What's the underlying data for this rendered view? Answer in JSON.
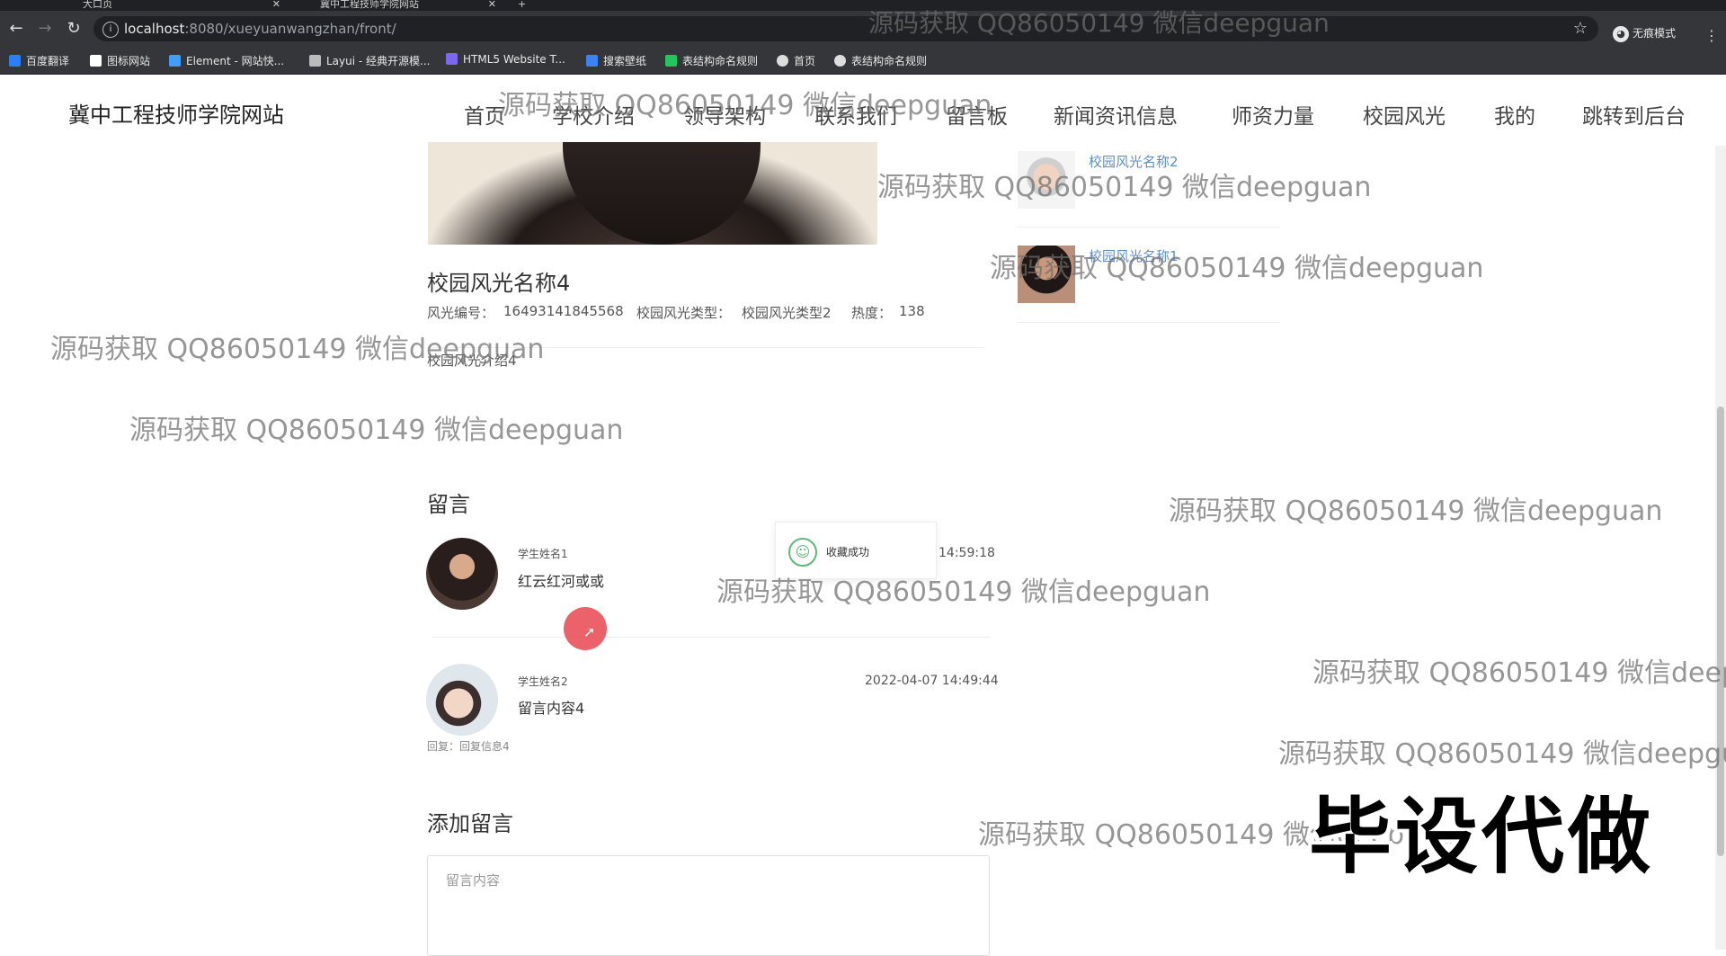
{
  "browser": {
    "tabs": [
      {
        "title": "大口页"
      },
      {
        "title": "冀中工程技师学院网站"
      }
    ],
    "new_tab": "+",
    "url_host": "localhost",
    "url_rest": ":8080/xueyuanwangzhan/front/",
    "profile": "无痕模式",
    "bookmarks": [
      {
        "label": "百度翻译",
        "color": "#2d7ff9"
      },
      {
        "label": "图标网站",
        "color": "#ffffff"
      },
      {
        "label": "Element - 网站快...",
        "color": "#409eff"
      },
      {
        "label": "Layui - 经典开源模...",
        "color": "#bbbbbb"
      },
      {
        "label": "HTML5 Website T...",
        "color": "#7b68ee"
      },
      {
        "label": "搜索壁纸",
        "color": "#3b82f6"
      },
      {
        "label": "表结构命名规则",
        "color": "#22c55e"
      },
      {
        "label": "首页",
        "color": "#dddddd"
      },
      {
        "label": "表结构命名规则",
        "color": "#dddddd"
      }
    ]
  },
  "site": {
    "title": "冀中工程技师学院网站",
    "nav": [
      "首页",
      "学校介绍",
      "领导架构",
      "联系我们",
      "留言板",
      "新闻资讯信息",
      "师资力量",
      "校园风光",
      "我的",
      "跳转到后台"
    ]
  },
  "detail": {
    "title": "校园风光名称4",
    "meta": {
      "id_label": "风光编号：",
      "id_value": "16493141845568",
      "type_label": "校园风光类型：",
      "type_value": "校园风光类型2",
      "heat_label": "热度：",
      "heat_value": "138"
    },
    "intro": "校园风光介绍4"
  },
  "comments": {
    "heading": "留言",
    "items": [
      {
        "name": "学生姓名1",
        "text": "红云红河或或",
        "time": "14:59:18",
        "reply": ""
      },
      {
        "name": "学生姓名2",
        "text": "留言内容4",
        "time": "2022-04-07 14:49:44",
        "reply": "回复：回复信息4"
      }
    ]
  },
  "add_comment": {
    "heading": "添加留言",
    "placeholder": "留言内容"
  },
  "sidebar": {
    "items": [
      {
        "label": "校园风光名称2"
      },
      {
        "label": "校园风光名称1"
      }
    ]
  },
  "toast": {
    "text": "收藏成功"
  },
  "watermark": {
    "text": "源码获取 QQ86050149 微信deepguan",
    "stamp": "毕设代做"
  }
}
